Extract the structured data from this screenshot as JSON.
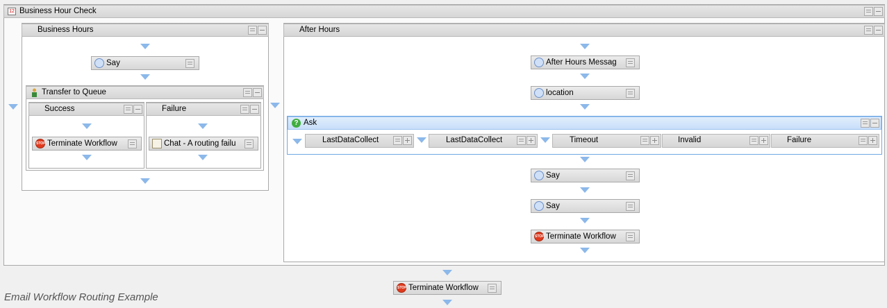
{
  "root": {
    "title": "Business Hour Check",
    "icon": "calendar-icon",
    "icon_text": "12"
  },
  "business_hours": {
    "title": "Business Hours",
    "say_label": "Say",
    "transfer": {
      "title": "Transfer to Queue"
    },
    "success": {
      "title": "Success",
      "terminate_label": "Terminate Workflow"
    },
    "failure": {
      "title": "Failure",
      "chat_label": "Chat - A routing failu"
    }
  },
  "after_hours": {
    "title": "After Hours",
    "message_label": "After Hours Messag",
    "location_label": "location",
    "ask": {
      "title": "Ask",
      "branches": [
        "LastDataCollect",
        "LastDataCollect",
        "Timeout",
        "Invalid",
        "Failure"
      ]
    },
    "say1_label": "Say",
    "say2_label": "Say",
    "terminate_label": "Terminate Workflow"
  },
  "final_terminate_label": "Terminate Workflow",
  "stop_icon_text": "STOP",
  "caption": "Email Workflow Routing Example",
  "colors": {
    "arrow": "#8cb8ea",
    "ask_header": "#cfe4fb",
    "selection": "#5b9be0"
  }
}
